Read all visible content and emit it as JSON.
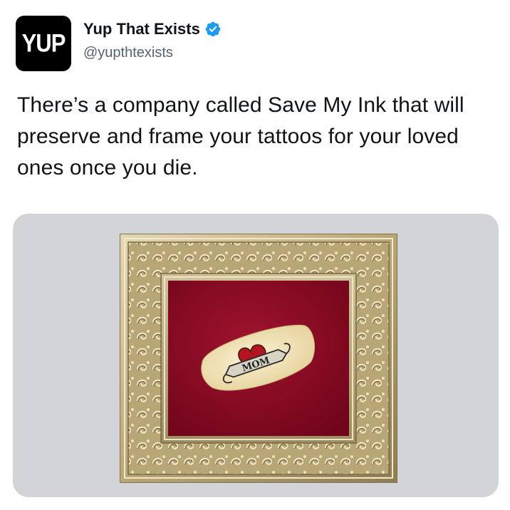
{
  "account": {
    "avatar_text": "YUP",
    "display_name": "Yup That Exists",
    "handle": "@yupthtexists",
    "verified": true
  },
  "tweet": {
    "text": "There’s a company called Save My Ink that will preserve and frame your tattoos for your loved ones once you die."
  },
  "media": {
    "tattoo_banner_text": "MOM",
    "colors": {
      "background": "#d3d4d8",
      "velvet": "#8e0a24",
      "frame_gold": "#c4b48a",
      "verified_blue": "#1d9bf0"
    }
  },
  "icons": {
    "verified": "verified-badge-icon"
  }
}
